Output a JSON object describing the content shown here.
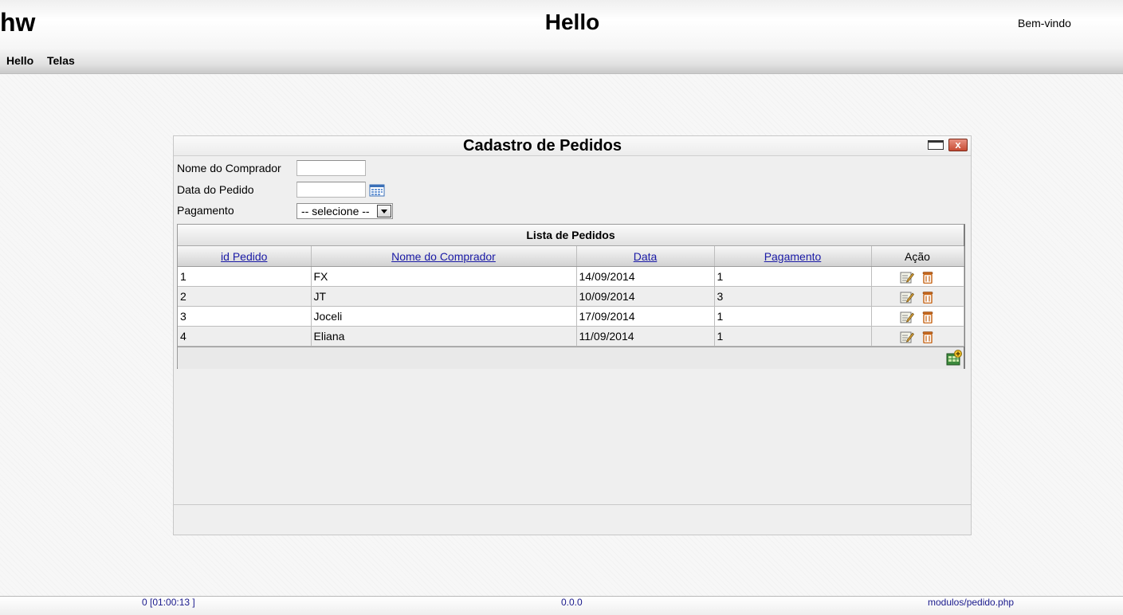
{
  "header": {
    "brand": "hw",
    "title": "Hello",
    "welcome": "Bem-vindo"
  },
  "menu": {
    "items": [
      {
        "label": "Hello"
      },
      {
        "label": "Telas"
      }
    ]
  },
  "window": {
    "title": "Cadastro de Pedidos",
    "close_label": "x"
  },
  "form": {
    "comprador": {
      "label": "Nome do Comprador",
      "value": ""
    },
    "data": {
      "label": "Data do Pedido",
      "value": ""
    },
    "pagamento": {
      "label": "Pagamento",
      "selected": "-- selecione --"
    }
  },
  "grid": {
    "caption": "Lista de Pedidos",
    "columns": [
      "id Pedido",
      "Nome do Comprador",
      "Data",
      "Pagamento",
      "Ação"
    ],
    "rows": [
      {
        "id": "1",
        "nome": "FX",
        "data": "14/09/2014",
        "pagamento": "1"
      },
      {
        "id": "2",
        "nome": "JT",
        "data": "10/09/2014",
        "pagamento": "3"
      },
      {
        "id": "3",
        "nome": "Joceli",
        "data": "17/09/2014",
        "pagamento": "1"
      },
      {
        "id": "4",
        "nome": "Eliana",
        "data": "11/09/2014",
        "pagamento": "1"
      }
    ],
    "row_actions": [
      "edit-icon",
      "trash-icon"
    ],
    "footer_action": "add-record-icon"
  },
  "status": {
    "left": "0 [01:00:13 ]",
    "center": "0.0.0",
    "right": "modulos/pedido.php"
  },
  "colors": {
    "link": "#1a1aa6",
    "status_text": "#1a1a8c",
    "close_button": "#c74b34"
  }
}
